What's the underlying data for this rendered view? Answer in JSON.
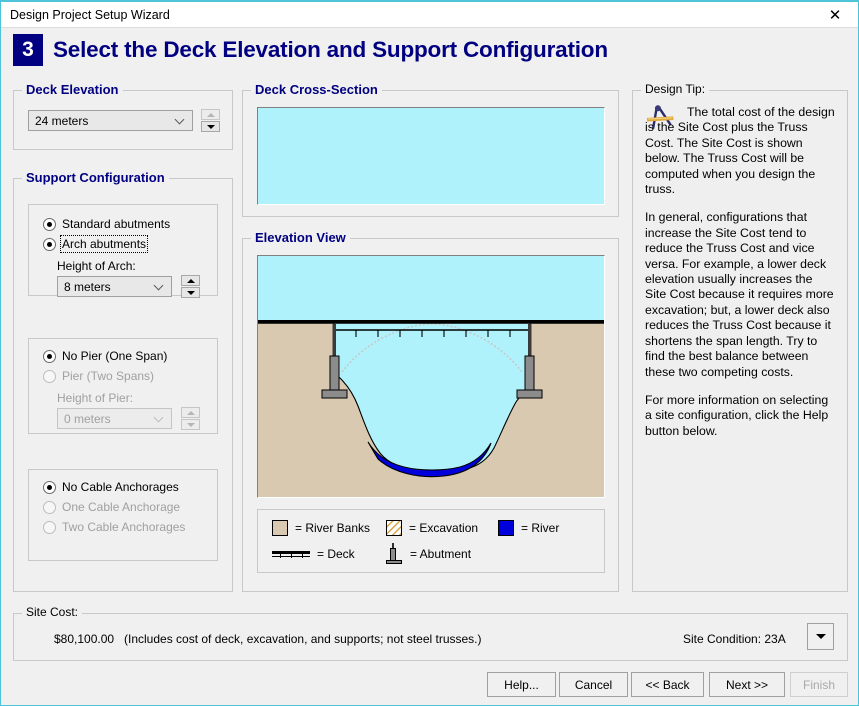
{
  "window": {
    "title": "Design Project Setup Wizard",
    "close_icon": "close-icon"
  },
  "header": {
    "step_number": "3",
    "title": "Select the Deck Elevation and Support Configuration",
    "badge_color": "#000080"
  },
  "deck_elevation": {
    "group_label": "Deck Elevation",
    "value": "24 meters",
    "spinner_up_enabled": "false",
    "spinner_down_enabled": "true"
  },
  "support_configuration": {
    "group_label": "Support Configuration",
    "abutments": {
      "options": [
        {
          "label": "Standard abutments",
          "selected": "false",
          "enabled": "true",
          "focused": "false"
        },
        {
          "label": "Arch abutments",
          "selected": "true",
          "enabled": "true",
          "focused": "true"
        }
      ],
      "height_label": "Height of Arch:",
      "height_value": "8 meters",
      "height_enabled": "true"
    },
    "piers": {
      "options": [
        {
          "label": "No Pier (One Span)",
          "selected": "true",
          "enabled": "true"
        },
        {
          "label": "Pier (Two Spans)",
          "selected": "false",
          "enabled": "false"
        }
      ],
      "height_label": "Height of Pier:",
      "height_value": "0 meters",
      "height_enabled": "false"
    },
    "anchorages": {
      "options": [
        {
          "label": "No Cable Anchorages",
          "selected": "true",
          "enabled": "true"
        },
        {
          "label": "One Cable Anchorage",
          "selected": "false",
          "enabled": "false"
        },
        {
          "label": "Two Cable Anchorages",
          "selected": "false",
          "enabled": "false"
        }
      ]
    }
  },
  "deck_cross_section": {
    "group_label": "Deck Cross-Section"
  },
  "elevation_view": {
    "group_label": "Elevation View",
    "legend": [
      {
        "key": "river-banks",
        "label": "= River Banks",
        "swatch": "#d9c9b0",
        "type": "fill"
      },
      {
        "key": "excavation",
        "label": "= Excavation",
        "swatch": "#ffffff",
        "type": "hatch"
      },
      {
        "key": "river",
        "label": "= River",
        "swatch": "#0000dd",
        "type": "fill"
      },
      {
        "key": "deck",
        "label": "= Deck",
        "swatch": "#000000",
        "type": "deck"
      },
      {
        "key": "abutment",
        "label": "= Abutment",
        "swatch": "#8c8c8c",
        "type": "abutment"
      }
    ],
    "colors": {
      "sky": "#b0f2fb",
      "ground": "#d9c9b0",
      "excavation": "#b0f2fb",
      "river": "#0000dd",
      "abutment": "#8c8c8c",
      "deck": "#000000",
      "arch_guide": "#c8c8c8"
    },
    "deck_tick_count": "9"
  },
  "design_tip": {
    "group_label": "Design Tip:",
    "icon": "compass-drafting-icon",
    "paragraphs": [
      "The total cost of the design is the Site Cost plus the Truss Cost. The Site Cost is shown below. The Truss Cost will be computed when you design the truss.",
      "In general, configurations that increase the Site Cost tend to reduce the Truss Cost and vice versa. For example, a lower deck elevation usually increases the Site Cost because it requires more excavation; but, a lower deck also reduces the Truss Cost because it shortens the span length. Try to find the best balance between these two competing costs.",
      "For more information on selecting a site configuration, click the Help button below."
    ]
  },
  "site_cost": {
    "group_label": "Site Cost:",
    "amount": "$80,100.00",
    "note": "(Includes cost of deck, excavation, and supports; not steel trusses.)",
    "condition_label": "Site Condition: 23A",
    "condition_dropdown_icon": "chevron-down-icon"
  },
  "footer_buttons": [
    {
      "key": "help",
      "label": "Help...",
      "enabled": "true"
    },
    {
      "key": "cancel",
      "label": "Cancel",
      "enabled": "true"
    },
    {
      "key": "back",
      "label": "<< Back",
      "enabled": "true"
    },
    {
      "key": "next",
      "label": "Next >>",
      "enabled": "true"
    },
    {
      "key": "finish",
      "label": "Finish",
      "enabled": "false"
    }
  ]
}
